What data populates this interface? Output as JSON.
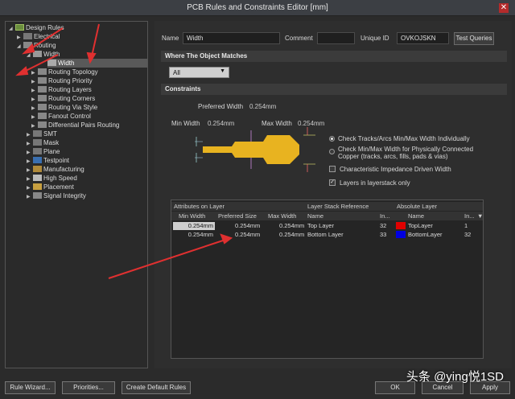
{
  "window": {
    "title": "PCB Rules and Constraints Editor [mm]",
    "close_glyph": "✕"
  },
  "tree": {
    "root": "Design Rules",
    "items": [
      {
        "label": "Electrical"
      },
      {
        "label": "Routing"
      },
      {
        "label": "Width"
      },
      {
        "label": "Width"
      },
      {
        "label": "Routing Topology"
      },
      {
        "label": "Routing Priority"
      },
      {
        "label": "Routing Layers"
      },
      {
        "label": "Routing Corners"
      },
      {
        "label": "Routing Via Style"
      },
      {
        "label": "Fanout Control"
      },
      {
        "label": "Differential Pairs Routing"
      },
      {
        "label": "SMT"
      },
      {
        "label": "Mask"
      },
      {
        "label": "Plane"
      },
      {
        "label": "Testpoint"
      },
      {
        "label": "Manufacturing"
      },
      {
        "label": "High Speed"
      },
      {
        "label": "Placement"
      },
      {
        "label": "Signal Integrity"
      }
    ]
  },
  "rule": {
    "name_label": "Name",
    "name_value": "Width",
    "comment_label": "Comment",
    "comment_value": "",
    "unique_id_label": "Unique ID",
    "unique_id_value": "OVKOJSKN",
    "test_queries_label": "Test Queries"
  },
  "where": {
    "header": "Where The Object Matches",
    "selected": "All"
  },
  "constraints": {
    "header": "Constraints",
    "preferred_label": "Preferred Width",
    "preferred_value": "0.254mm",
    "min_label": "Min Width",
    "min_value": "0.254mm",
    "max_label": "Max Width",
    "max_value": "0.254mm",
    "option1": "Check Tracks/Arcs Min/Max Width Individually",
    "option2_line1": "Check Min/Max Width for Physically Connected",
    "option2_line2": "Copper (tracks, arcs, fills, pads & vias)",
    "option3": "Characteristic Impedance Driven Width",
    "option4": "Layers in layerstack only",
    "check_glyph": "✓"
  },
  "table": {
    "group_attrs": "Attributes on Layer",
    "group_stack": "Layer Stack Reference",
    "group_abs": "Absolute Layer",
    "col_min": "Min Width",
    "col_pref": "Preferred Size",
    "col_max": "Max Width",
    "col_name": "Name",
    "col_index": "In...",
    "col_abs_name": "Name",
    "col_abs_index": "In...",
    "rows": [
      {
        "min": "0.254mm",
        "pref": "0.254mm",
        "max": "0.254mm",
        "name": "Top Layer",
        "index": "32",
        "abs_name": "TopLayer",
        "abs_index": "1",
        "color": "#e00000"
      },
      {
        "min": "0.254mm",
        "pref": "0.254mm",
        "max": "0.254mm",
        "name": "Bottom Layer",
        "index": "33",
        "abs_name": "BottomLayer",
        "abs_index": "32",
        "color": "#0000e0"
      }
    ]
  },
  "footer": {
    "rule_wizard": "Rule Wizard...",
    "priorities": "Priorities...",
    "create_default": "Create Default Rules",
    "ok": "OK",
    "cancel": "Cancel",
    "apply": "Apply"
  },
  "watermark": "头条 @ying悦1SD",
  "colors": {
    "track": "#e8b320",
    "accent_arrow": "#e03030"
  }
}
